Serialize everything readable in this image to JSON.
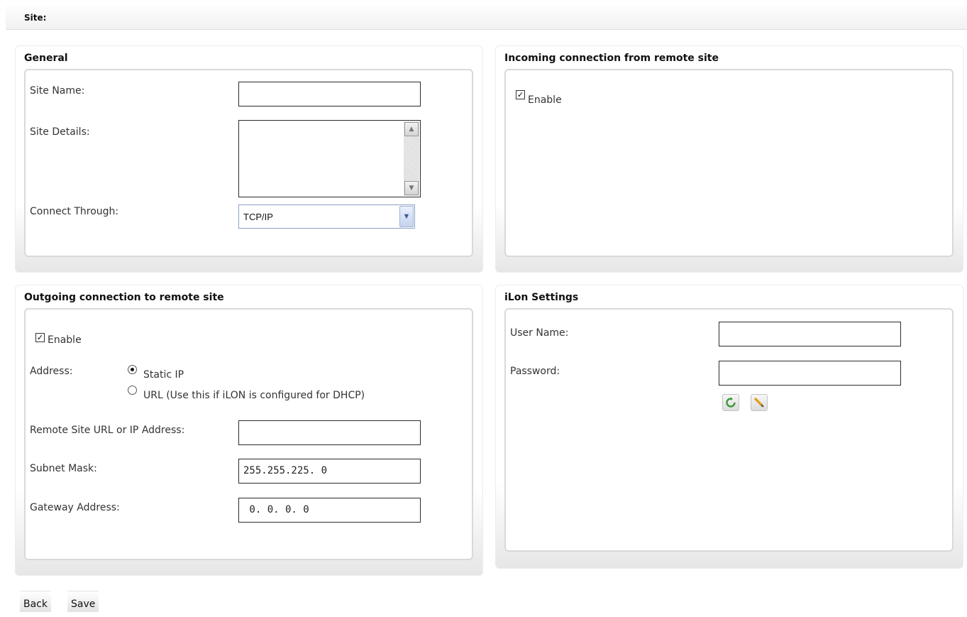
{
  "header": {
    "site_label": "Site:"
  },
  "general": {
    "title": "General",
    "site_name_label": "Site Name:",
    "site_name_value": "",
    "site_details_label": "Site Details:",
    "connect_through_label": "Connect Through:",
    "connect_through_value": "TCP/IP"
  },
  "incoming": {
    "title": "Incoming connection from remote site",
    "enable_label": "Enable",
    "enable_checked": true
  },
  "outgoing": {
    "title": "Outgoing connection to remote site",
    "enable_label": "Enable",
    "enable_checked": true,
    "address_label": "Address:",
    "static_ip_label": "Static IP",
    "url_label": "URL (Use this if iLON is configured for DHCP)",
    "address_selected": "Static IP",
    "remote_site_label": "Remote Site URL or IP Address:",
    "remote_site_value": "",
    "subnet_mask_label": "Subnet Mask:",
    "subnet_mask_value": "255.255.225. 0",
    "gateway_label": "Gateway Address:",
    "gateway_value": " 0. 0. 0. 0"
  },
  "ilon": {
    "title": "iLon Settings",
    "user_name_label": "User Name:",
    "user_name_value": "",
    "password_label": "Password:",
    "password_value": "",
    "icons": [
      "refresh-icon",
      "edit-pencil-icon"
    ]
  },
  "footer": {
    "back_label": "Back",
    "save_label": "Save"
  }
}
